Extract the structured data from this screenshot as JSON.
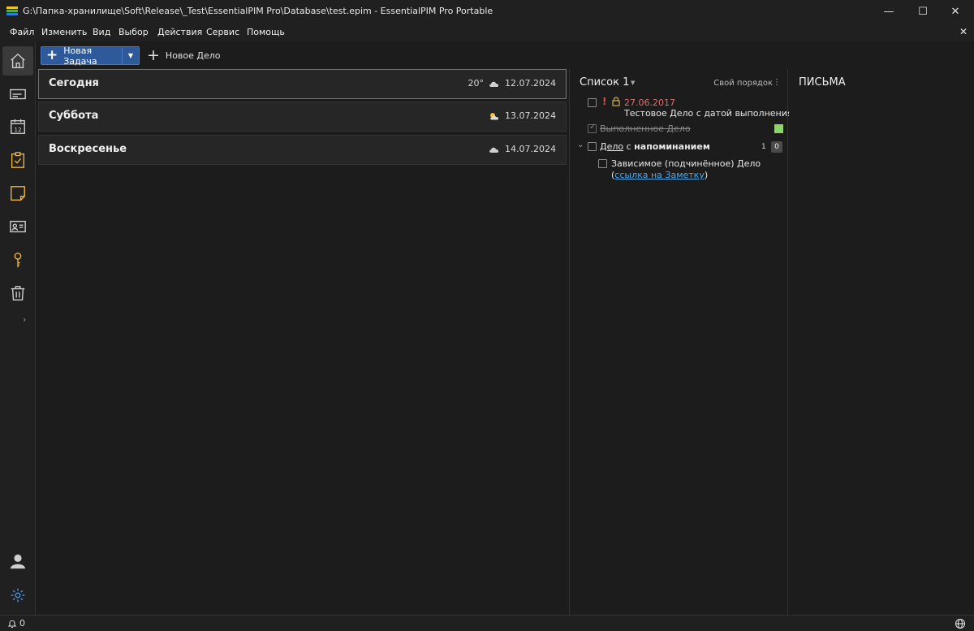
{
  "window": {
    "title": "G:\\Папка-хранилище\\Soft\\Release\\_Test\\EssentialPIM Pro\\Database\\test.epim - EssentialPIM Pro Portable",
    "controls": {
      "minimize": "—",
      "maximize": "☐",
      "close": "✕"
    }
  },
  "menu": {
    "items": [
      "Файл",
      "Изменить",
      "Вид",
      "Выбор",
      "Действия",
      "Сервис",
      "Помощь"
    ],
    "close": "✕"
  },
  "sidebar": {
    "items": [
      "home-icon",
      "mail-icon",
      "calendar-icon",
      "tasks-icon",
      "notes-icon",
      "contacts-icon",
      "passwords-icon",
      "trash-icon"
    ],
    "calendar_day": "12",
    "expand": "›",
    "bottom": [
      "user-icon",
      "settings-icon"
    ]
  },
  "toolbar": {
    "new_task": "Новая Задача",
    "new_deal": "Новое Дело",
    "plus": "+",
    "dropdown": "▼"
  },
  "days": [
    {
      "name": "Сегодня",
      "temp": "20°",
      "date": "12.07.2024",
      "weather": "cloud-icon"
    },
    {
      "name": "Суббота",
      "temp": "",
      "date": "13.07.2024",
      "weather": "sun-cloud-icon"
    },
    {
      "name": "Воскресенье",
      "temp": "",
      "date": "14.07.2024",
      "weather": "cloud-icon"
    }
  ],
  "tasks": {
    "list_title": "Список 1",
    "list_dropdown": "▼",
    "sort_label": "Свой порядок",
    "sort_menu": "⋮",
    "colors": {
      "accent_green": "#8fd46a",
      "date_red": "#e06c6c",
      "link_blue": "#4ea6e8"
    },
    "items": [
      {
        "priority": "!",
        "lock": "🔒",
        "date": "27.06.2017",
        "title": "Тестовое Дело с датой выполнения"
      },
      {
        "title": "Выполненное Дело",
        "done": true
      },
      {
        "expand": "⌄",
        "title_part1": "Дело",
        "title_part2": " с ",
        "title_part3": "напоминанием",
        "count": "1",
        "badge": "0"
      },
      {
        "title": "Зависимое (подчинённое) Дело",
        "paren_open": "(",
        "link": "ссылка на Заметку",
        "paren_close": ")"
      }
    ]
  },
  "mail": {
    "title": "ПИСЬМА"
  },
  "status": {
    "bell_count": "0",
    "bell": "🔔"
  }
}
